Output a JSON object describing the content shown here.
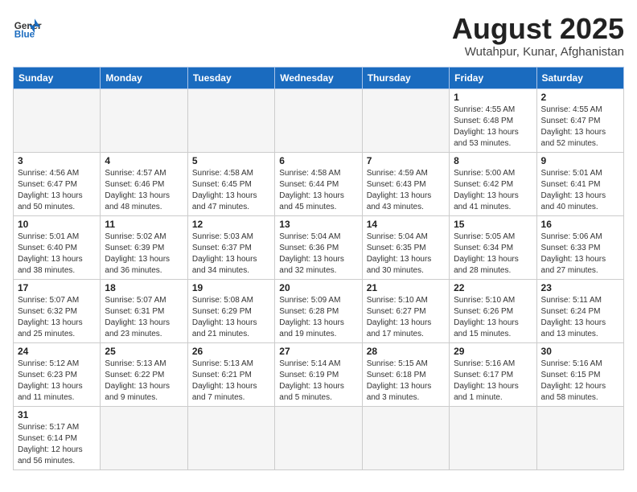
{
  "header": {
    "logo_general": "General",
    "logo_blue": "Blue",
    "month_year": "August 2025",
    "location": "Wutahpur, Kunar, Afghanistan"
  },
  "weekdays": [
    "Sunday",
    "Monday",
    "Tuesday",
    "Wednesday",
    "Thursday",
    "Friday",
    "Saturday"
  ],
  "weeks": [
    [
      {
        "day": "",
        "info": ""
      },
      {
        "day": "",
        "info": ""
      },
      {
        "day": "",
        "info": ""
      },
      {
        "day": "",
        "info": ""
      },
      {
        "day": "",
        "info": ""
      },
      {
        "day": "1",
        "info": "Sunrise: 4:55 AM\nSunset: 6:48 PM\nDaylight: 13 hours and 53 minutes."
      },
      {
        "day": "2",
        "info": "Sunrise: 4:55 AM\nSunset: 6:47 PM\nDaylight: 13 hours and 52 minutes."
      }
    ],
    [
      {
        "day": "3",
        "info": "Sunrise: 4:56 AM\nSunset: 6:47 PM\nDaylight: 13 hours and 50 minutes."
      },
      {
        "day": "4",
        "info": "Sunrise: 4:57 AM\nSunset: 6:46 PM\nDaylight: 13 hours and 48 minutes."
      },
      {
        "day": "5",
        "info": "Sunrise: 4:58 AM\nSunset: 6:45 PM\nDaylight: 13 hours and 47 minutes."
      },
      {
        "day": "6",
        "info": "Sunrise: 4:58 AM\nSunset: 6:44 PM\nDaylight: 13 hours and 45 minutes."
      },
      {
        "day": "7",
        "info": "Sunrise: 4:59 AM\nSunset: 6:43 PM\nDaylight: 13 hours and 43 minutes."
      },
      {
        "day": "8",
        "info": "Sunrise: 5:00 AM\nSunset: 6:42 PM\nDaylight: 13 hours and 41 minutes."
      },
      {
        "day": "9",
        "info": "Sunrise: 5:01 AM\nSunset: 6:41 PM\nDaylight: 13 hours and 40 minutes."
      }
    ],
    [
      {
        "day": "10",
        "info": "Sunrise: 5:01 AM\nSunset: 6:40 PM\nDaylight: 13 hours and 38 minutes."
      },
      {
        "day": "11",
        "info": "Sunrise: 5:02 AM\nSunset: 6:39 PM\nDaylight: 13 hours and 36 minutes."
      },
      {
        "day": "12",
        "info": "Sunrise: 5:03 AM\nSunset: 6:37 PM\nDaylight: 13 hours and 34 minutes."
      },
      {
        "day": "13",
        "info": "Sunrise: 5:04 AM\nSunset: 6:36 PM\nDaylight: 13 hours and 32 minutes."
      },
      {
        "day": "14",
        "info": "Sunrise: 5:04 AM\nSunset: 6:35 PM\nDaylight: 13 hours and 30 minutes."
      },
      {
        "day": "15",
        "info": "Sunrise: 5:05 AM\nSunset: 6:34 PM\nDaylight: 13 hours and 28 minutes."
      },
      {
        "day": "16",
        "info": "Sunrise: 5:06 AM\nSunset: 6:33 PM\nDaylight: 13 hours and 27 minutes."
      }
    ],
    [
      {
        "day": "17",
        "info": "Sunrise: 5:07 AM\nSunset: 6:32 PM\nDaylight: 13 hours and 25 minutes."
      },
      {
        "day": "18",
        "info": "Sunrise: 5:07 AM\nSunset: 6:31 PM\nDaylight: 13 hours and 23 minutes."
      },
      {
        "day": "19",
        "info": "Sunrise: 5:08 AM\nSunset: 6:29 PM\nDaylight: 13 hours and 21 minutes."
      },
      {
        "day": "20",
        "info": "Sunrise: 5:09 AM\nSunset: 6:28 PM\nDaylight: 13 hours and 19 minutes."
      },
      {
        "day": "21",
        "info": "Sunrise: 5:10 AM\nSunset: 6:27 PM\nDaylight: 13 hours and 17 minutes."
      },
      {
        "day": "22",
        "info": "Sunrise: 5:10 AM\nSunset: 6:26 PM\nDaylight: 13 hours and 15 minutes."
      },
      {
        "day": "23",
        "info": "Sunrise: 5:11 AM\nSunset: 6:24 PM\nDaylight: 13 hours and 13 minutes."
      }
    ],
    [
      {
        "day": "24",
        "info": "Sunrise: 5:12 AM\nSunset: 6:23 PM\nDaylight: 13 hours and 11 minutes."
      },
      {
        "day": "25",
        "info": "Sunrise: 5:13 AM\nSunset: 6:22 PM\nDaylight: 13 hours and 9 minutes."
      },
      {
        "day": "26",
        "info": "Sunrise: 5:13 AM\nSunset: 6:21 PM\nDaylight: 13 hours and 7 minutes."
      },
      {
        "day": "27",
        "info": "Sunrise: 5:14 AM\nSunset: 6:19 PM\nDaylight: 13 hours and 5 minutes."
      },
      {
        "day": "28",
        "info": "Sunrise: 5:15 AM\nSunset: 6:18 PM\nDaylight: 13 hours and 3 minutes."
      },
      {
        "day": "29",
        "info": "Sunrise: 5:16 AM\nSunset: 6:17 PM\nDaylight: 13 hours and 1 minute."
      },
      {
        "day": "30",
        "info": "Sunrise: 5:16 AM\nSunset: 6:15 PM\nDaylight: 12 hours and 58 minutes."
      }
    ],
    [
      {
        "day": "31",
        "info": "Sunrise: 5:17 AM\nSunset: 6:14 PM\nDaylight: 12 hours and 56 minutes."
      },
      {
        "day": "",
        "info": ""
      },
      {
        "day": "",
        "info": ""
      },
      {
        "day": "",
        "info": ""
      },
      {
        "day": "",
        "info": ""
      },
      {
        "day": "",
        "info": ""
      },
      {
        "day": "",
        "info": ""
      }
    ]
  ]
}
